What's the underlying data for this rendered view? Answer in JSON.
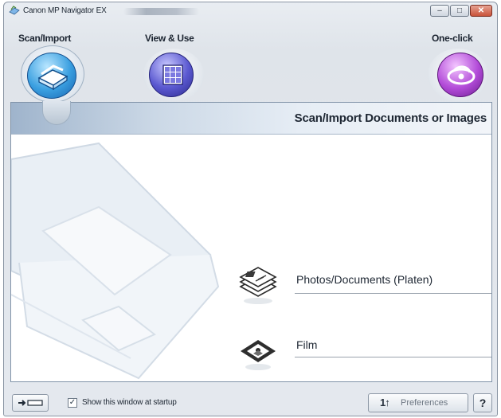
{
  "window": {
    "title": "Canon MP Navigator EX",
    "controls": [
      "minimize",
      "maximize",
      "close"
    ]
  },
  "modes": {
    "scan_import": {
      "label": "Scan/Import",
      "icon": "scanner-icon",
      "selected": true
    },
    "view_use": {
      "label": "View & Use",
      "icon": "photo-grid-icon",
      "selected": false
    },
    "one_click": {
      "label": "One-click",
      "icon": "one-click-icon",
      "selected": false
    }
  },
  "panel": {
    "title": "Scan/Import Documents or Images",
    "actions": [
      {
        "label": "Photos/Documents (Platen)",
        "icon": "documents-stack-icon"
      },
      {
        "label": "Film",
        "icon": "film-strip-icon"
      }
    ]
  },
  "footer": {
    "show_at_startup_label": "Show this window at startup",
    "show_at_startup_checked": true,
    "preferences_label": "Preferences",
    "help_label": "?"
  },
  "colors": {
    "scan_accent": "#3a9fe0",
    "view_accent": "#5a58d0",
    "oneclick_accent": "#b24bd8",
    "header_gradient": "#9fb4cc"
  }
}
